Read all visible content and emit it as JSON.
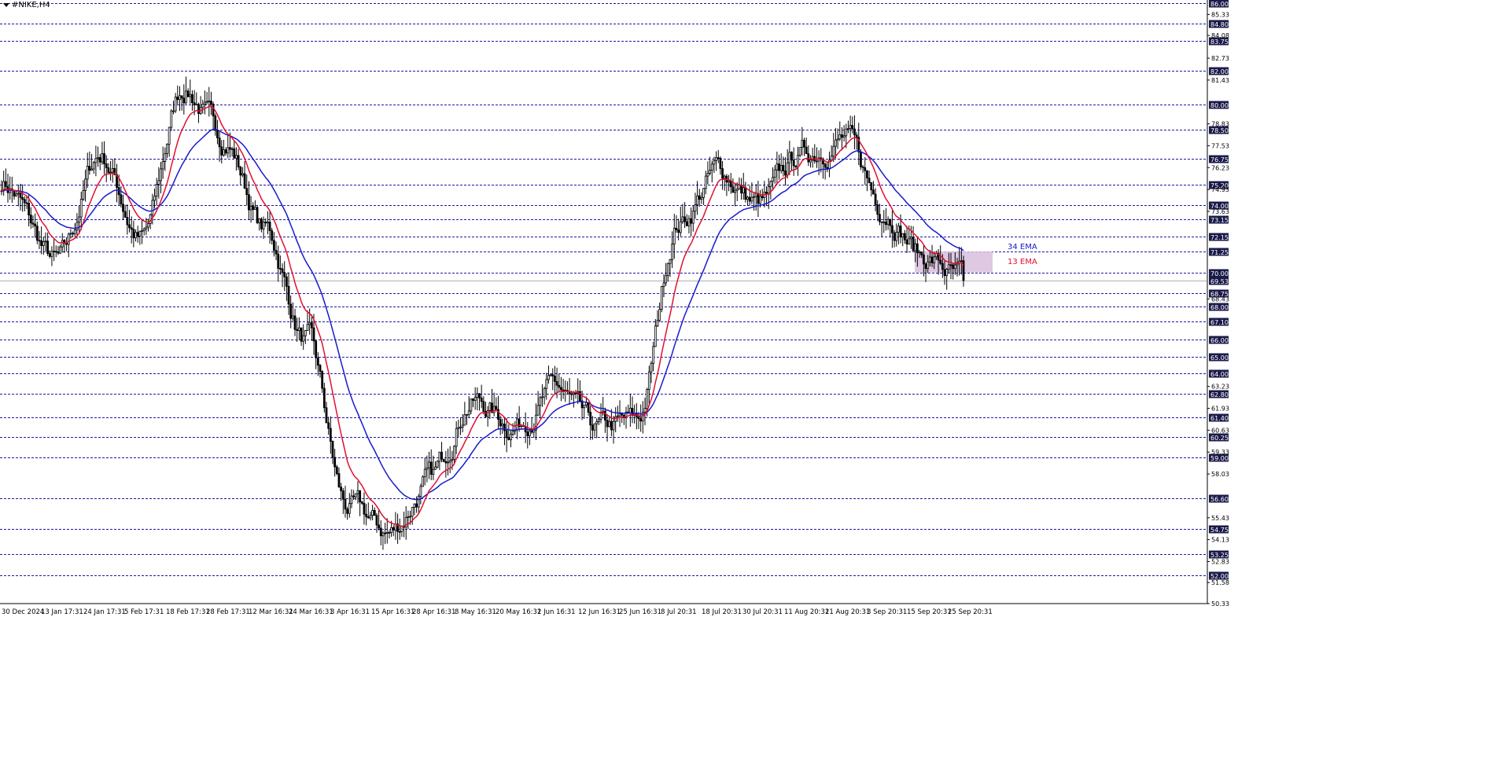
{
  "symbol": "#NIKE,H4",
  "colors": {
    "background": "#ffffff",
    "grid": "#1a1aa0",
    "candle": "#000000",
    "ema_fast": "#e01030",
    "ema_slow": "#1a1acc",
    "zone": "#d8bedd",
    "badge_bg": "#1a1a4a",
    "badge_text": "#ffffff",
    "axis_text": "#000000"
  },
  "chart_data": {
    "type": "candlestick",
    "title": "#NIKE,H4",
    "ylim": [
      50.33,
      86.0
    ],
    "y_tick_labels": [
      "85.33",
      "84.08",
      "82.73",
      "81.43",
      "78.83",
      "77.53",
      "76.23",
      "74.93",
      "73.63",
      "68.43",
      "63.23",
      "61.93",
      "60.63",
      "59.33",
      "58.03",
      "55.43",
      "54.13",
      "52.83",
      "51.58",
      "50.33"
    ],
    "price_levels": [
      86.0,
      84.8,
      83.75,
      82.0,
      80.0,
      78.5,
      76.75,
      75.2,
      74.0,
      73.15,
      72.15,
      71.25,
      70.0,
      69.53,
      68.75,
      68.0,
      67.1,
      66.0,
      65.0,
      64.0,
      62.8,
      61.4,
      60.25,
      59.0,
      56.6,
      54.75,
      53.25,
      52.0
    ],
    "price_level_labels": [
      "86.00",
      "84.80",
      "83.75",
      "82.00",
      "80.00",
      "78.50",
      "76.75",
      "75.20",
      "74.00",
      "73.15",
      "72.15",
      "71.25",
      "70.00",
      "69.53",
      "68.75",
      "68.00",
      "67.10",
      "66.00",
      "65.00",
      "64.00",
      "62.80",
      "61.40",
      "60.25",
      "59.00",
      "56.60",
      "54.75",
      "53.25",
      "52.00"
    ],
    "current_price": 69.53,
    "x_labels": [
      "30 Dec 2024",
      "13 Jan 17:31",
      "24 Jan 17:31",
      "5 Feb 17:31",
      "18 Feb 17:31",
      "28 Feb 17:31",
      "12 Mar 16:31",
      "24 Mar 16:31",
      "3 Apr 16:31",
      "15 Apr 16:31",
      "28 Apr 16:31",
      "8 May 16:31",
      "20 May 16:31",
      "2 Jun 16:31",
      "12 Jun 16:31",
      "25 Jun 16:31",
      "8 Jul 20:31",
      "18 Jul 20:31",
      "30 Jul 20:31",
      "11 Aug 20:31",
      "21 Aug 20:31",
      "3 Sep 20:31",
      "15 Sep 20:31",
      "25 Sep 20:31"
    ],
    "price_path": [
      [
        "30 Dec 2024",
        75.4
      ],
      [
        "13 Jan 17:31",
        70.5
      ],
      [
        "24 Jan 17:31",
        77.0
      ],
      [
        "5 Feb 17:31",
        72.0
      ],
      [
        "18 Feb 17:31",
        81.0
      ],
      [
        "28 Feb 17:31",
        78.0
      ],
      [
        "12 Mar 16:31",
        72.5
      ],
      [
        "24 Mar 16:31",
        66.0
      ],
      [
        "3 Apr 16:31",
        56.0
      ],
      [
        "15 Apr 16:31",
        54.5
      ],
      [
        "28 Apr 16:31",
        57.5
      ],
      [
        "8 May 16:31",
        62.5
      ],
      [
        "20 May 16:31",
        61.0
      ],
      [
        "2 Jun 16:31",
        63.0
      ],
      [
        "12 Jun 16:31",
        60.5
      ],
      [
        "25 Jun 16:31",
        61.0
      ],
      [
        "8 Jul 20:31",
        73.0
      ],
      [
        "18 Jul 20:31",
        76.0
      ],
      [
        "30 Jul 20:31",
        74.0
      ],
      [
        "11 Aug 20:31",
        77.0
      ],
      [
        "21 Aug 20:31",
        78.0
      ],
      [
        "3 Sep 20:31",
        74.0
      ],
      [
        "15 Sep 20:31",
        71.0
      ],
      [
        "25 Sep 20:31",
        69.5
      ]
    ],
    "series": [
      {
        "name": "13 EMA",
        "color": "#e01030"
      },
      {
        "name": "34 EMA",
        "color": "#1a1acc"
      }
    ],
    "annotations": {
      "ema_slow_label": "34 EMA",
      "ema_fast_label": "13 EMA",
      "zone": {
        "from": 70.0,
        "to": 71.25,
        "start": "15 Sep 20:31",
        "end": "25 Sep 20:31"
      }
    },
    "grid": true
  }
}
